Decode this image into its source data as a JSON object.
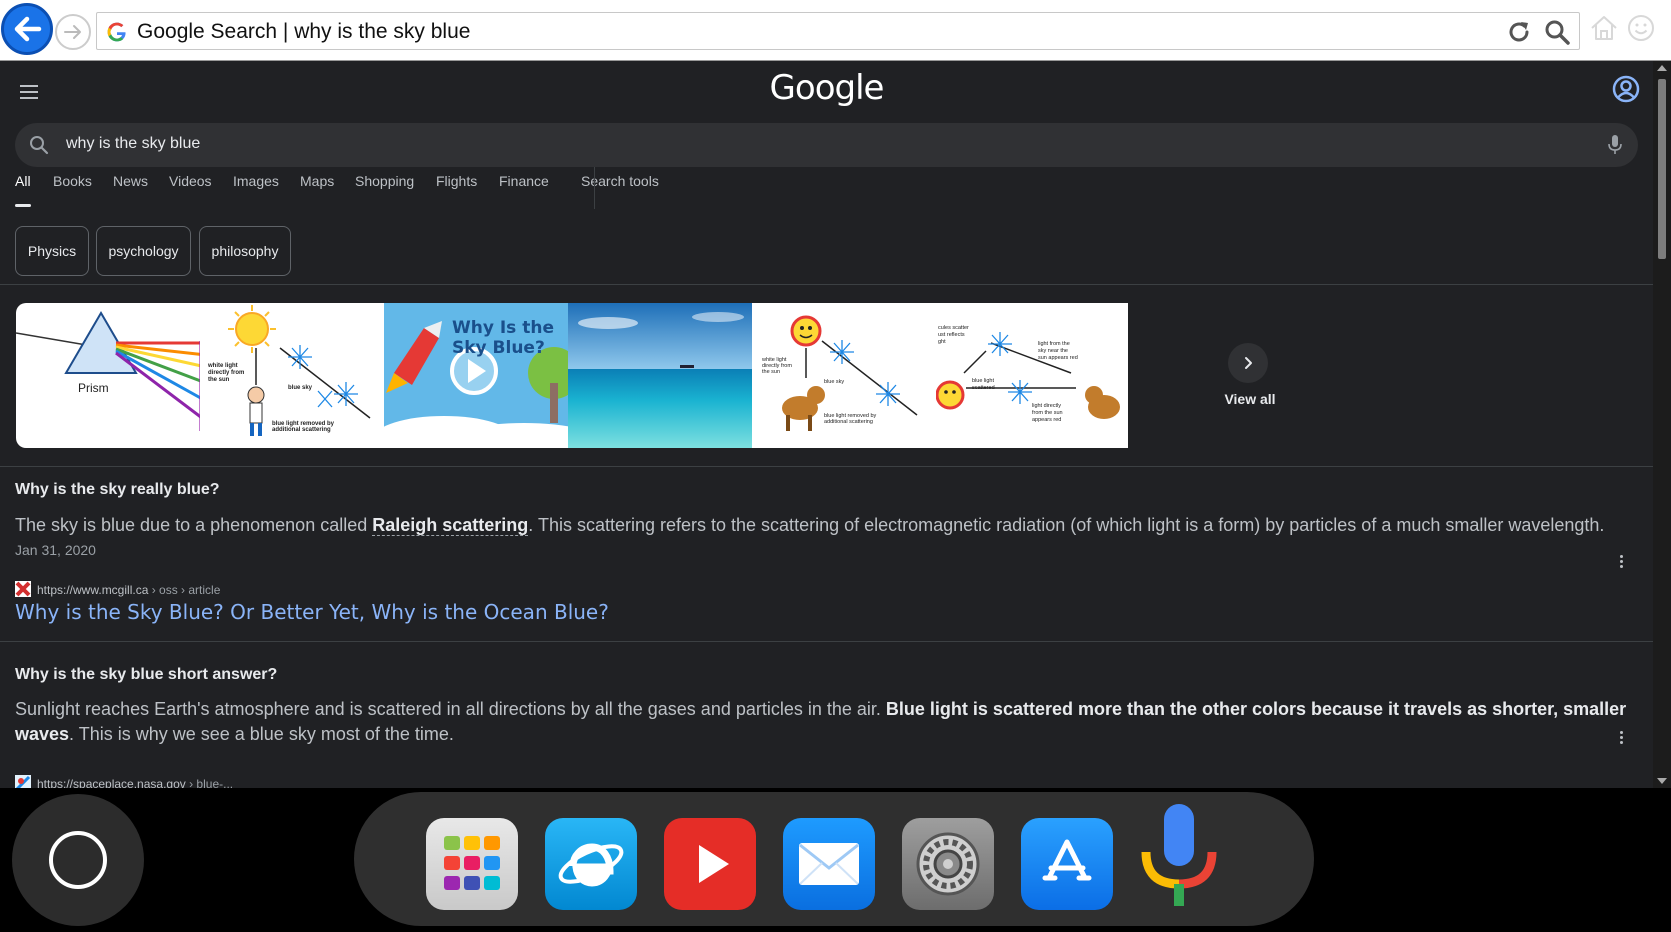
{
  "browser": {
    "url_text": "Google Search | why is the sky blue"
  },
  "header": {
    "logo": "Google"
  },
  "search": {
    "query": "why is the sky blue"
  },
  "tabs": [
    {
      "label": "All",
      "active": true
    },
    {
      "label": "Books"
    },
    {
      "label": "News"
    },
    {
      "label": "Videos"
    },
    {
      "label": "Images"
    },
    {
      "label": "Maps"
    },
    {
      "label": "Shopping"
    },
    {
      "label": "Flights"
    },
    {
      "label": "Finance"
    },
    {
      "label": "Search tools"
    }
  ],
  "chips": [
    "Physics",
    "psychology",
    "philosophy"
  ],
  "images": {
    "view_all": "View all",
    "thumb_texts": {
      "prism": "Prism",
      "video_title_1": "Why Is the",
      "video_title_2": "Sky Blue?"
    }
  },
  "results": [
    {
      "question": "Why is the sky really blue?",
      "answer_pre": "The sky is blue due to a phenomenon called ",
      "answer_term": "Raleigh scattering",
      "answer_post": ". This scattering refers to the scattering of electromagnetic radiation (of which light is a form) by particles of a much smaller wavelength.",
      "date": "Jan 31, 2020",
      "site": "https://www.mcgill.ca",
      "path": " › oss › article",
      "link": "Why is the Sky Blue? Or Better Yet, Why is the Ocean Blue?"
    },
    {
      "question": "Why is the sky blue short answer?",
      "answer_pre": "Sunlight reaches Earth's atmosphere and is scattered in all directions by all the gases and particles in the air. ",
      "answer_bold": "Blue light is scattered more than the other colors because it travels as shorter, smaller waves",
      "answer_post": ". This is why we see a blue sky most of the time.",
      "site": "https://spaceplace.nasa.gov",
      "path": " › blue-..."
    }
  ],
  "dock": {
    "apps": [
      "launchpad-icon",
      "internet-explorer-icon",
      "youtube-icon",
      "mail-icon",
      "settings-icon",
      "app-store-icon",
      "voice-search-icon"
    ]
  },
  "colors": {
    "page_bg": "#202124",
    "link": "#8ab4f8",
    "accent": "#1a73e8"
  }
}
